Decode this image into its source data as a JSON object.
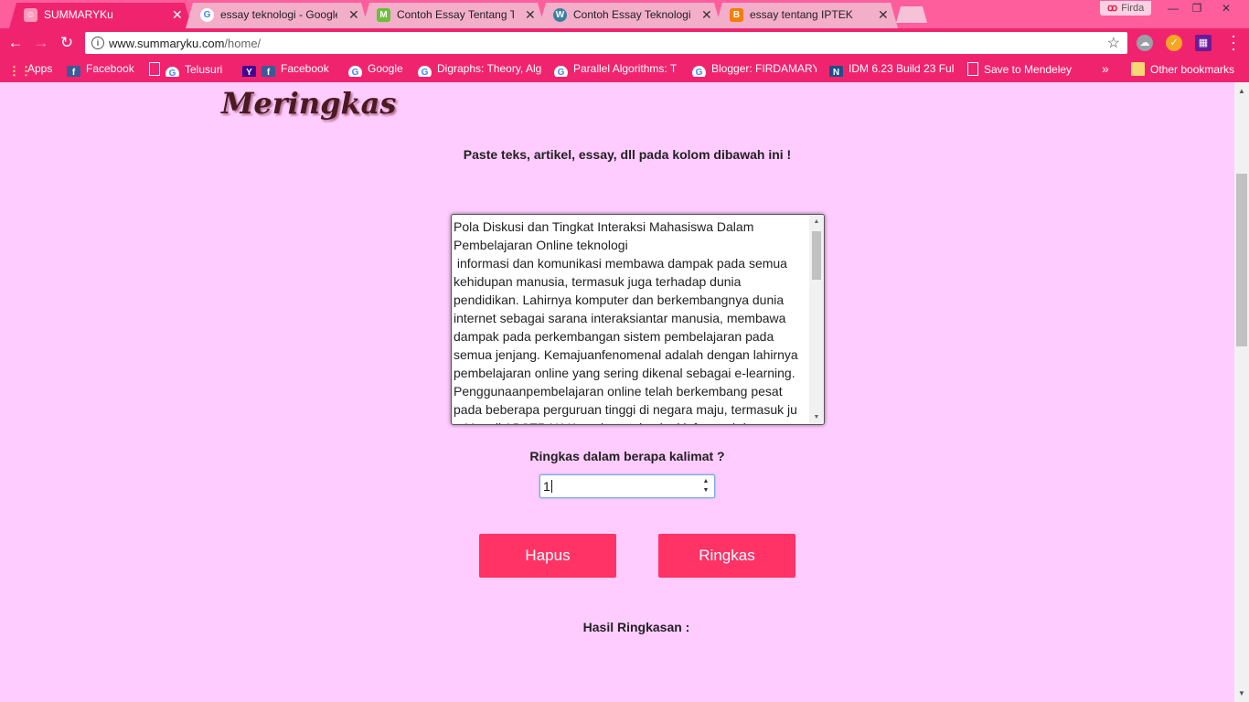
{
  "browser": {
    "tabs": [
      {
        "title": "SUMMARYKu",
        "icon": "summaryku-favicon",
        "active": true
      },
      {
        "title": "essay teknologi - Google",
        "icon": "google-favicon"
      },
      {
        "title": "Contoh Essay Tentang Te",
        "icon": "green-favicon"
      },
      {
        "title": "Contoh Essay Teknologi",
        "icon": "wordpress-favicon"
      },
      {
        "title": "essay tentang IPTEK",
        "icon": "blogger-favicon"
      }
    ],
    "profile_name": "Firda",
    "url_host": "www.summaryku.com",
    "url_path": "/home/",
    "bookmarks": [
      {
        "label": "Apps",
        "icon": "apps-icon"
      },
      {
        "label": "Facebook",
        "icon": "facebook-icon"
      },
      {
        "label": "Telusuri",
        "icon": "page-icon"
      },
      {
        "label": "Facebook",
        "icon": "yahoo-icon"
      },
      {
        "label": "Google",
        "icon": "google-icon"
      },
      {
        "label": "Digraphs: Theory, Alg",
        "icon": "google-icon"
      },
      {
        "label": "Parallel Algorithms: T",
        "icon": "google-icon"
      },
      {
        "label": "Blogger: FIRDAMARY",
        "icon": "google-icon"
      },
      {
        "label": "IDM 6.23 Build 23 Ful",
        "icon": "idm-icon"
      },
      {
        "label": "Save to Mendeley",
        "icon": "page-icon"
      }
    ],
    "other_bookmarks": "Other bookmarks",
    "more_chevron": "»",
    "colors": {
      "tabstrip": "#ff5e9c",
      "toolbar": "#f0246e"
    }
  },
  "page": {
    "logo": "Meringkas",
    "instruction": "Paste teks, artikel, essay, dll pada kolom dibawah ini !",
    "textarea_text": "Pola Diskusi dan Tingkat Interaksi Mahasiswa Dalam Pembelajaran Online teknologi\n informasi dan komunikasi membawa dampak pada semua kehidupan manusia, termasuk juga terhadap dunia pendidikan. Lahirnya komputer dan berkembangnya dunia internet sebagai sarana interaksiantar manusia, membawa dampak pada perkembangan sistem pembelajaran pada semua jenjang. Kemajuanfenomenal adalah dengan lahirnya pembelajaran online yang sering dikenal sebagai e-learning. Penggunaanpembelajaran online telah berkembang pesat pada beberapa perguruan tinggi di negara maju, termasuk ju\n   Munzil ABSTRAK Kemajuan teknologi informasi dan",
    "sentences_label": "Ringkas dalam berapa kalimat ?",
    "sentences_value": "1",
    "clear_button": "Hapus",
    "summarize_button": "Ringkas",
    "result_label": "Hasil Ringkasan :",
    "colors": {
      "background": "#ffccff",
      "button": "#ff3366"
    }
  }
}
